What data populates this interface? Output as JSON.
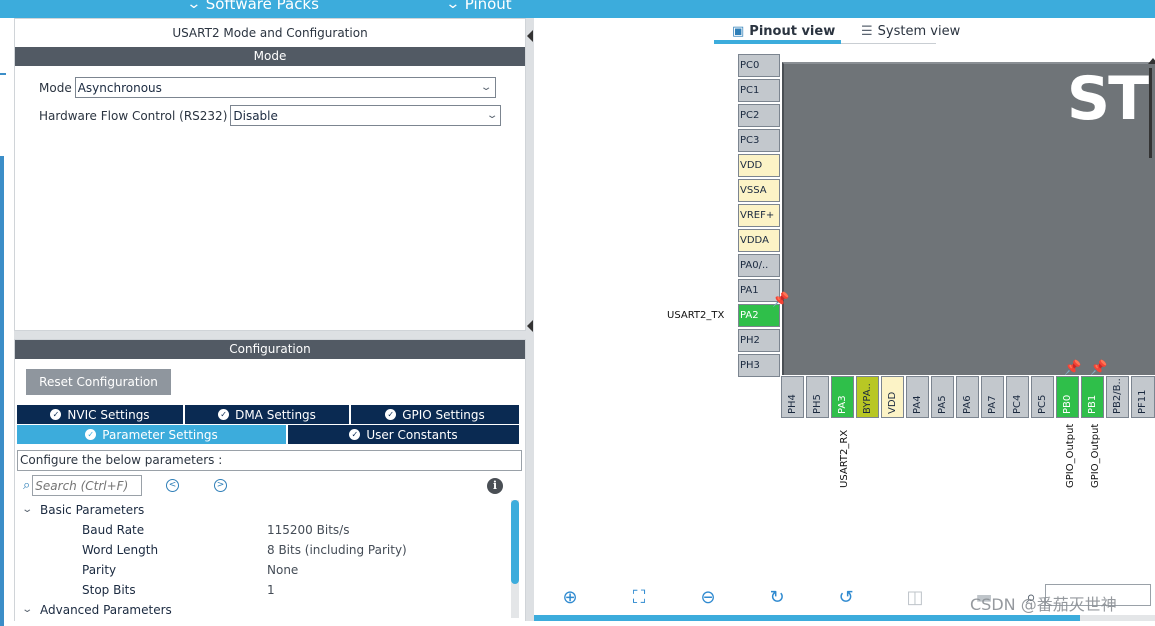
{
  "topbar": {
    "software_packs": "Software Packs",
    "pinout": "Pinout"
  },
  "mode_panel": {
    "title": "USART2 Mode and Configuration",
    "section": "Mode",
    "mode_label": "Mode",
    "mode_value": "Asynchronous",
    "hwflow_label": "Hardware Flow Control (RS232)",
    "hwflow_value": "Disable"
  },
  "config_panel": {
    "section": "Configuration",
    "reset_button": "Reset Configuration",
    "tabs_row1": [
      "NVIC Settings",
      "DMA Settings",
      "GPIO Settings"
    ],
    "tabs_row2": [
      "Parameter Settings",
      "User Constants"
    ],
    "note": "Configure the below parameters :",
    "search_placeholder": "Search (Ctrl+F)",
    "groups": {
      "basic": "Basic Parameters",
      "advanced": "Advanced Parameters"
    },
    "params": [
      {
        "name": "Baud Rate",
        "value": "115200 Bits/s"
      },
      {
        "name": "Word Length",
        "value": "8 Bits (including Parity)"
      },
      {
        "name": "Parity",
        "value": "None"
      },
      {
        "name": "Stop Bits",
        "value": "1"
      }
    ]
  },
  "right": {
    "tab_pinout": "Pinout view",
    "tab_system": "System view",
    "chip_logo": "ST",
    "left_pins": [
      "PC0",
      "PC1",
      "PC2",
      "PC3",
      "VDD",
      "VSSA",
      "VREF+",
      "VDDA",
      "PA0/..",
      "PA1",
      "PA2",
      "PH2",
      "PH3"
    ],
    "bottom_pins": [
      "PH4",
      "PH5",
      "PA3",
      "BYPA..",
      "VDD",
      "PA4",
      "PA5",
      "PA6",
      "PA7",
      "PC4",
      "PC5",
      "PB0",
      "PB1",
      "PB2/B..",
      "PF11"
    ],
    "signals": {
      "pa2": "USART2_TX",
      "pa3": "USART2_RX",
      "pb0": "GPIO_Output",
      "pb1": "GPIO_Output"
    },
    "watermark": "CSDN @番茄灭世神"
  }
}
